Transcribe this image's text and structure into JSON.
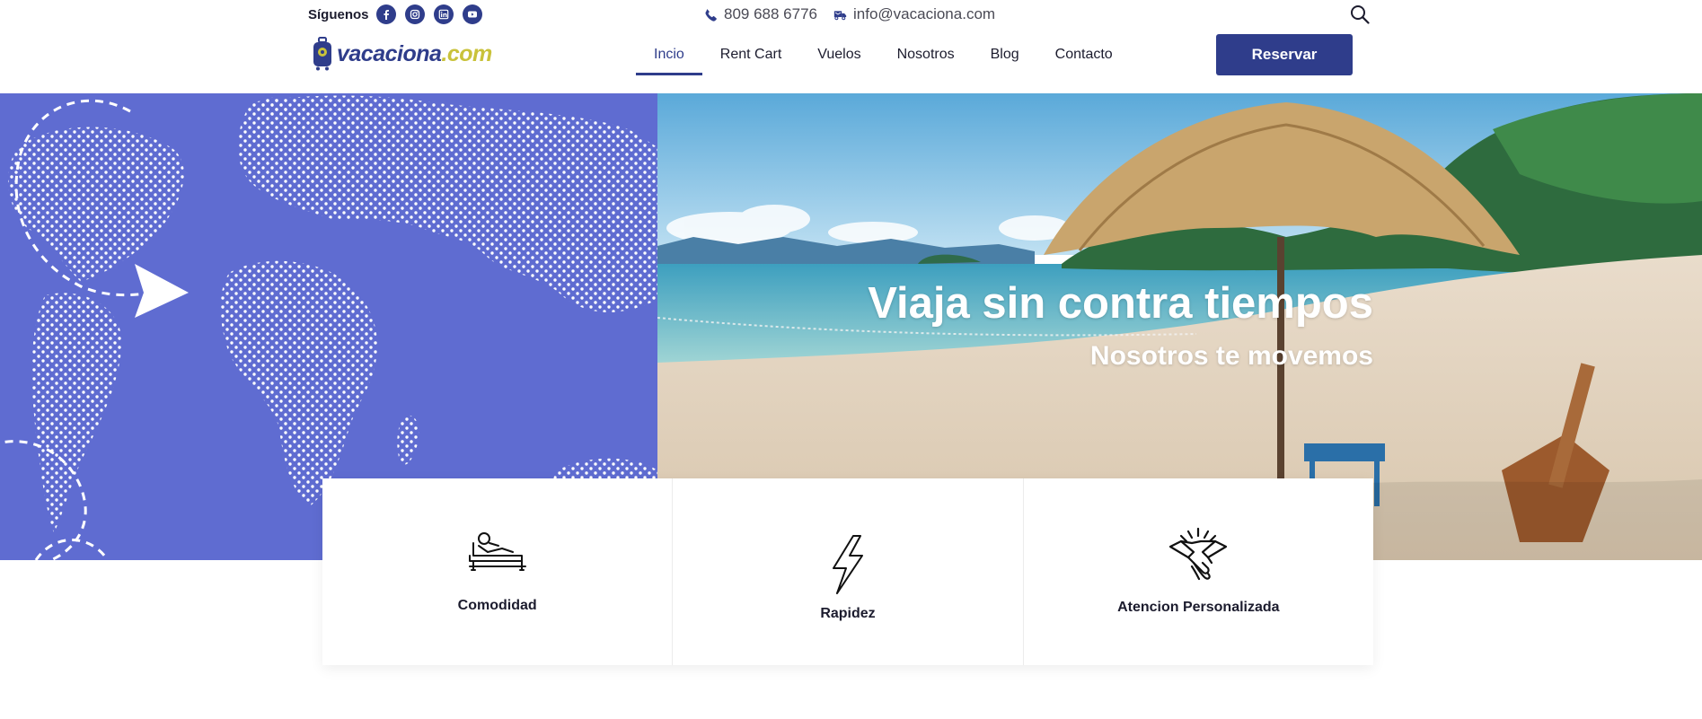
{
  "topbar": {
    "follow_label": "Síguenos",
    "social": [
      "facebook-icon",
      "instagram-icon",
      "linkedin-icon",
      "youtube-icon"
    ],
    "phone": "809 688 6776",
    "email": "info@vacaciona.com"
  },
  "header": {
    "logo_part1": "vacaciona",
    "logo_part2": ".com",
    "nav": [
      {
        "label": "Incio",
        "active": true
      },
      {
        "label": "Rent Cart",
        "active": false
      },
      {
        "label": "Vuelos",
        "active": false
      },
      {
        "label": "Nosotros",
        "active": false
      },
      {
        "label": "Blog",
        "active": false
      },
      {
        "label": "Contacto",
        "active": false
      }
    ],
    "reserve_label": "Reservar"
  },
  "hero": {
    "title": "Viaja sin contra tiempos",
    "subtitle": "Nosotros te movemos"
  },
  "features": [
    {
      "label": "Comodidad",
      "icon": "lounge-chair-icon"
    },
    {
      "label": "Rapidez",
      "icon": "lightning-icon"
    },
    {
      "label": "Atencion Personalizada",
      "icon": "handshake-icon"
    }
  ],
  "colors": {
    "brand": "#2f3d8b",
    "hero_blue": "#5f6cd1",
    "logo_accent": "#c9c23a"
  }
}
